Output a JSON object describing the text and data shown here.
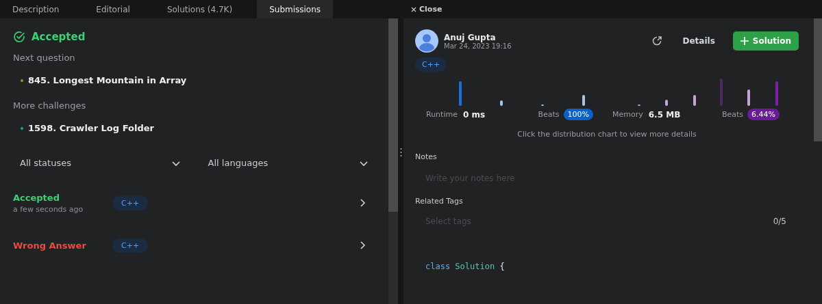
{
  "tabs": [
    {
      "label": "Description",
      "selected": false
    },
    {
      "label": "Editorial",
      "selected": false
    },
    {
      "label": "Solutions (4.7K)",
      "selected": false
    },
    {
      "label": "Submissions",
      "selected": true
    }
  ],
  "result": {
    "status": "Accepted"
  },
  "next_question": {
    "heading": "Next question",
    "items": [
      {
        "title": "845. Longest Mountain in Array",
        "color": "#b8860b"
      }
    ]
  },
  "more_challenges": {
    "heading": "More challenges",
    "items": [
      {
        "title": "1598. Crawler Log Folder",
        "color": "#1aa39a"
      }
    ]
  },
  "filters": [
    {
      "label": "All statuses"
    },
    {
      "label": "All languages"
    }
  ],
  "submissions": [
    {
      "status": "Accepted",
      "kind": "accepted",
      "time": "a few seconds ago",
      "language": "C++"
    },
    {
      "status": "Wrong Answer",
      "kind": "wrong",
      "language": "C++"
    }
  ],
  "close_button": {
    "label": "Close"
  },
  "detail": {
    "author": "Anuj Gupta",
    "date": "Mar 24, 2023 19:16",
    "details_button": "Details",
    "solution_button": "Solution",
    "language": "C++",
    "stats": [
      {
        "label": "Runtime",
        "value": "0 ms",
        "beats_label": "Beats",
        "beats": "100%",
        "color": "#0a62c9"
      },
      {
        "label": "Memory",
        "value": "6.5 MB",
        "beats_label": "Beats",
        "beats": "6.44%",
        "color": "#6a1b9a"
      }
    ],
    "hint": "Click the distribution chart to view more details"
  },
  "notes": {
    "heading": "Notes",
    "placeholder": "Write your notes here"
  },
  "tags": {
    "heading": "Related Tags",
    "placeholder": "Select tags",
    "count": "0/5"
  },
  "code": [
    {
      "text": "class",
      "kind": "keyword"
    },
    {
      "text": "Solution",
      "kind": "type"
    },
    {
      "text": "{",
      "kind": "punct"
    }
  ]
}
